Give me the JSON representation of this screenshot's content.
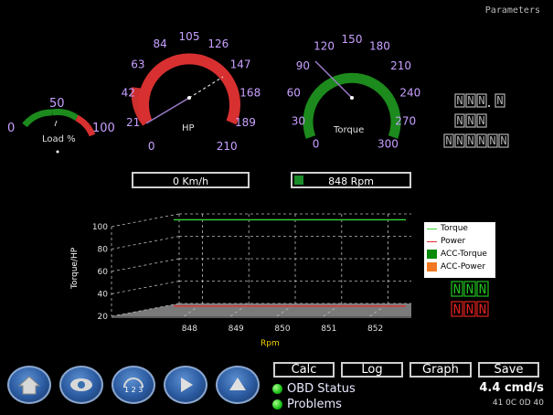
{
  "header": {
    "parameters_label": "Parameters"
  },
  "gauges": {
    "load": {
      "label": "Load %",
      "ticks": [
        "0",
        "50",
        "100"
      ],
      "value": 25
    },
    "hp": {
      "label": "HP",
      "ticks": [
        "0",
        "21",
        "42",
        "63",
        "84",
        "105",
        "126",
        "147",
        "168",
        "189",
        "210"
      ],
      "value": 55
    },
    "torque": {
      "label": "Torque",
      "ticks": [
        "0",
        "30",
        "60",
        "90",
        "120",
        "150",
        "180",
        "210",
        "240",
        "270",
        "300"
      ],
      "value": 95
    }
  },
  "readouts": {
    "speed": "0 Km/h",
    "rpm": "848 Rpm",
    "rpm_fill_fraction": 0.08
  },
  "digits": {
    "row1": [
      "NNN",
      "N"
    ],
    "row2": "NNN",
    "row3": "NNNNNN",
    "green_pair": "NNN",
    "red_pair": "NNN"
  },
  "chart_data": {
    "type": "line",
    "xlabel": "Rpm",
    "ylabel": "Torque/HP",
    "x_ticks": [
      "848",
      "849",
      "850",
      "851",
      "852"
    ],
    "y_ticks": [
      "100",
      "80",
      "60",
      "40",
      "20"
    ],
    "ylim": [
      20,
      100
    ],
    "legend": [
      "Torque",
      "Power",
      "ACC-Torque",
      "ACC-Power"
    ],
    "legend_colors": [
      "#37d437",
      "#e03030",
      "#0a8a0a",
      "#f07820"
    ],
    "series": [
      {
        "name": "Torque",
        "x": [
          848,
          849,
          850,
          851,
          852
        ],
        "values": [
          98,
          98,
          98,
          98,
          98
        ]
      },
      {
        "name": "Power",
        "x": [
          848,
          849,
          850,
          851,
          852
        ],
        "values": [
          21,
          21,
          21,
          21,
          21
        ]
      }
    ]
  },
  "toolbar": {
    "calc": "Calc",
    "log": "Log",
    "graph": "Graph",
    "save": "Save",
    "digits_icon_text": "1 2 3"
  },
  "status": {
    "obd": "OBD Status",
    "problems": "Problems",
    "rate": "4.4 cmd/s",
    "hex": "41 0C 0D 40"
  },
  "colors": {
    "gauge_green": "#1c8a1c",
    "gauge_red": "#d83030",
    "tick_purple": "#c8a0ff"
  }
}
